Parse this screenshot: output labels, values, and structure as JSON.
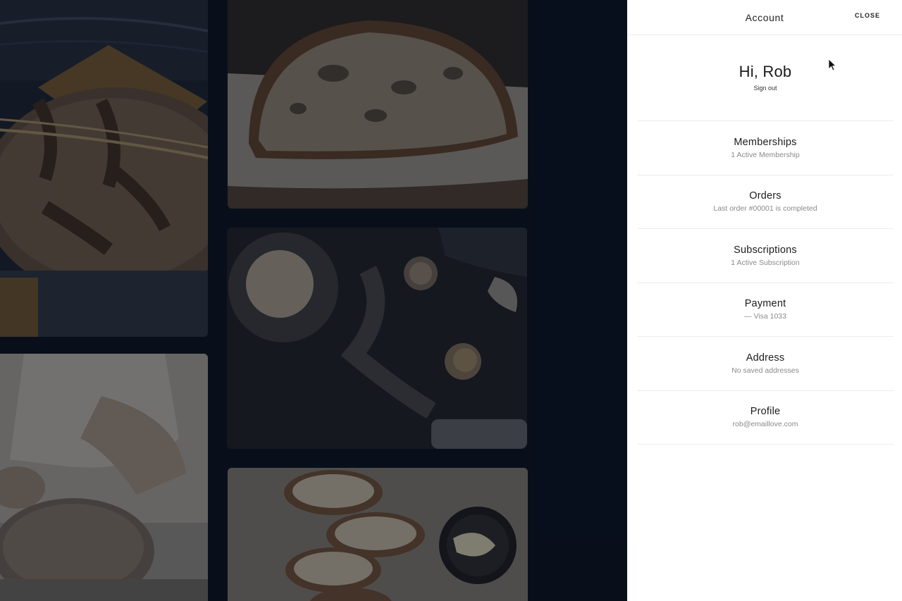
{
  "panel": {
    "title": "Account",
    "close_label": "CLOSE",
    "greeting": "Hi, Rob",
    "sign_out_label": "Sign out",
    "items": [
      {
        "label": "Memberships",
        "sub": "1 Active Membership"
      },
      {
        "label": "Orders",
        "sub": "Last order #00001 is completed"
      },
      {
        "label": "Subscriptions",
        "sub": "1 Active Subscription"
      },
      {
        "label": "Payment",
        "sub": "— Visa 1033"
      },
      {
        "label": "Address",
        "sub": "No saved addresses"
      },
      {
        "label": "Profile",
        "sub": "rob@emaillove.com"
      }
    ]
  },
  "colors": {
    "backdrop": "#070d16",
    "panel_bg": "#ffffff",
    "divider": "#ececec",
    "muted_text": "#8a8a8a"
  }
}
